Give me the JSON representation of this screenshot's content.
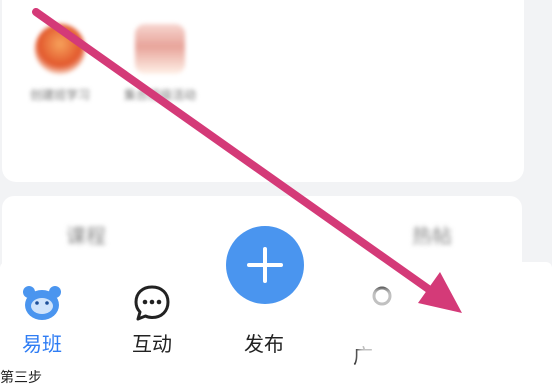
{
  "top_apps": [
    {
      "label": "创建班学习",
      "icon": "burger-app-icon"
    },
    {
      "label": "集合班级活动",
      "icon": "shopping-bag-app-icon"
    }
  ],
  "mid_tabs": [
    "课程",
    "热帖"
  ],
  "bottom_nav": {
    "items": [
      {
        "label": "易班",
        "icon": "bear-face-icon",
        "active": true
      },
      {
        "label": "互动",
        "icon": "chat-bubble-icon",
        "active": false
      },
      {
        "label": "发布",
        "icon": "plus-icon",
        "active": false
      },
      {
        "label": "广",
        "icon": "group-icon",
        "active": false
      }
    ],
    "active_color": "#2f7df4",
    "publish_color": "#4a95ef"
  },
  "annotation": {
    "arrow_color": "#d43a78"
  },
  "caption": "第三步"
}
